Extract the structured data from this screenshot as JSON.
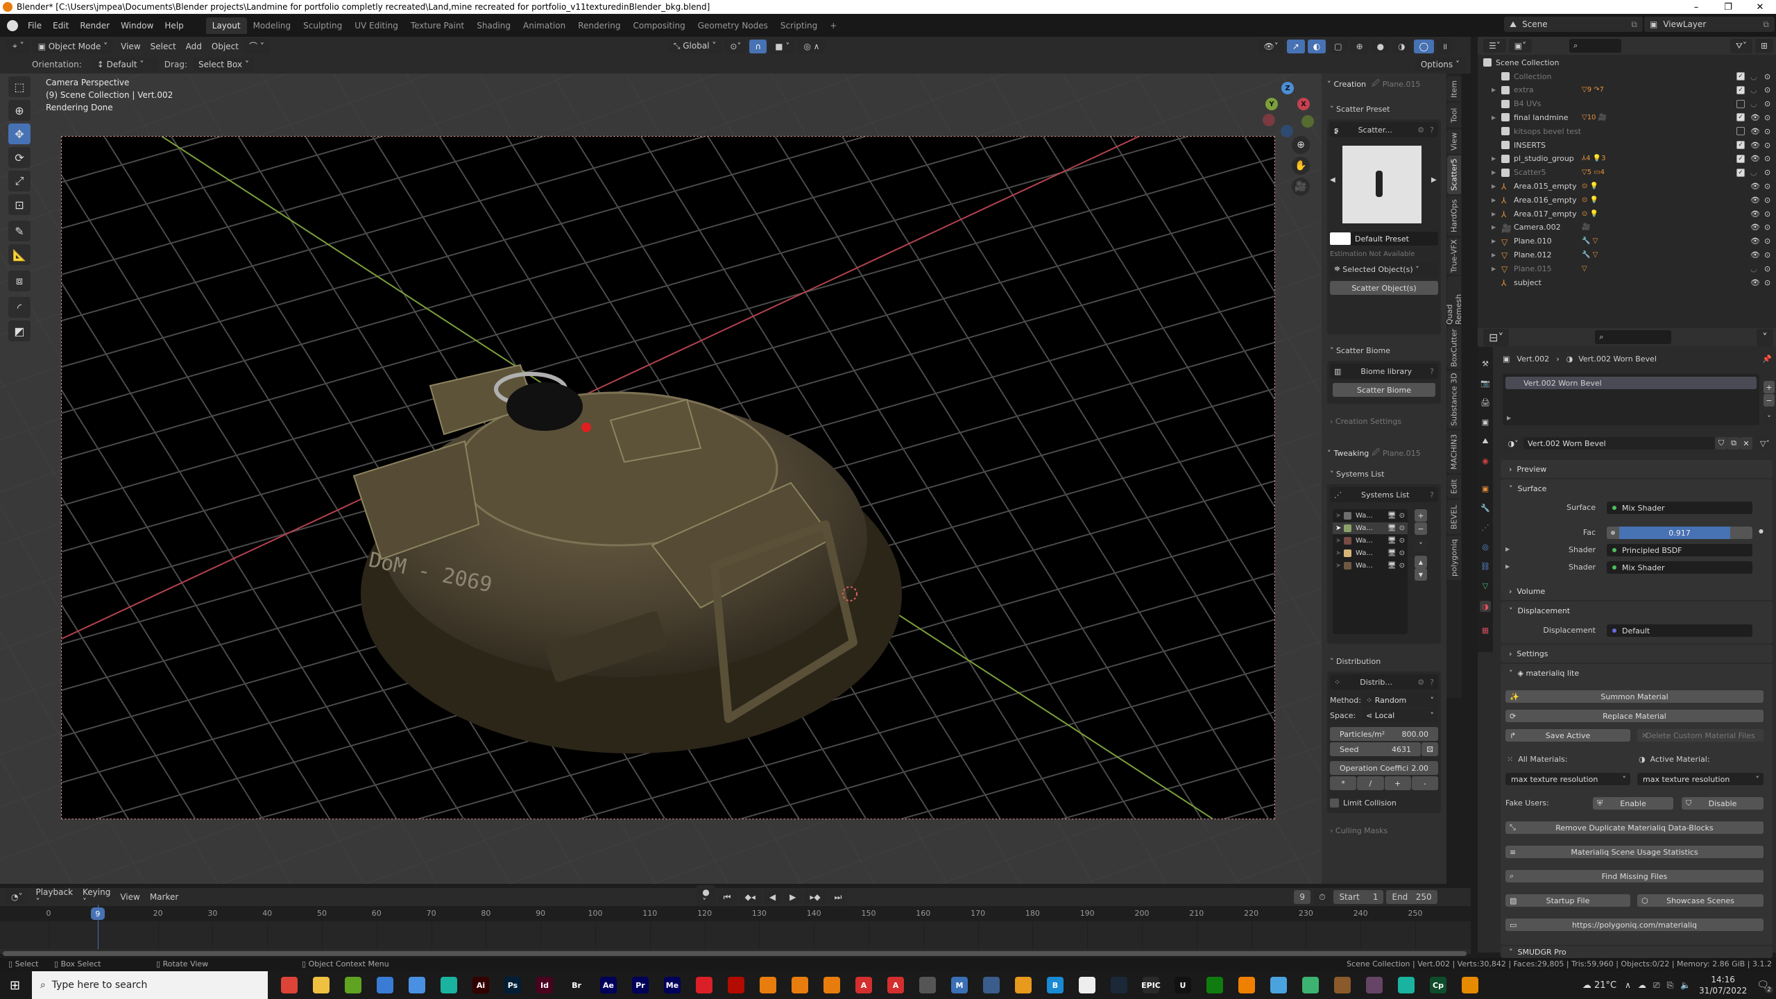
{
  "window": {
    "title": "Blender* [C:\\Users\\jmpea\\Documents\\Blender projects\\Landmine for portfolio completly recreated\\Land,mine recreated for portfolio_v11texturedinBlender_bkg.blend]",
    "controls": [
      "–",
      "❐",
      "✕"
    ]
  },
  "menu": [
    "File",
    "Edit",
    "Render",
    "Window",
    "Help"
  ],
  "workspaces": [
    {
      "label": "Layout",
      "active": true
    },
    {
      "label": "Modeling"
    },
    {
      "label": "Sculpting"
    },
    {
      "label": "UV Editing"
    },
    {
      "label": "Texture Paint"
    },
    {
      "label": "Shading"
    },
    {
      "label": "Animation"
    },
    {
      "label": "Rendering"
    },
    {
      "label": "Compositing"
    },
    {
      "label": "Geometry Nodes"
    },
    {
      "label": "Scripting"
    },
    {
      "label": "+"
    }
  ],
  "scene": {
    "name": "Scene",
    "view_layer": "ViewLayer"
  },
  "viewport_header": {
    "mode": "Object Mode",
    "menus": [
      "View",
      "Select",
      "Add",
      "Object"
    ],
    "transform_orientation": "Global",
    "options_label": "Options"
  },
  "tool_settings": {
    "orientation_label": "Orientation:",
    "orientation_value": "Default",
    "drag_label": "Drag:",
    "drag_value": "Select Box"
  },
  "viewport": {
    "info_lines": [
      "Camera Perspective",
      "(9) Scene Collection | Vert.002",
      "Rendering Done"
    ],
    "gizmo": {
      "x": "X",
      "y": "Y",
      "z": "Z"
    },
    "tools": [
      "select-box",
      "cursor",
      "move",
      "rotate",
      "scale",
      "transform",
      "annotate",
      "measure",
      "add-cube",
      "extrude",
      "knife"
    ],
    "active_tool": "move",
    "colors": {
      "x_axis": "#b5434f",
      "y_axis": "#7da13a",
      "mine": "#4d4430"
    },
    "stencil_text": "DoM - 2069"
  },
  "npanel": {
    "tabs": [
      "Item",
      "Tool",
      "View",
      "Scatter5",
      "HardOps",
      "True-VFX",
      "Quad Remesh",
      "BoxCutter",
      "Substance 3D",
      "MACHIN3",
      "Edit",
      "BEVEL",
      "polygoniq"
    ],
    "active_tab": "Scatter5",
    "creation": {
      "title": "Creation",
      "target": "Plane.015",
      "scatter_preset_label": "Scatter Preset",
      "preset_box_label": "Scatter...",
      "preset_name": "Default Preset",
      "estimation": "Estimation Not Available",
      "selected_objects": "Selected Object(s)",
      "scatter_objects_btn": "Scatter Object(s)",
      "scatter_biome_label": "Scatter Biome",
      "biome_library": "Biome library",
      "scatter_biome_btn": "Scatter Biome",
      "creation_settings": "Creation Settings"
    },
    "tweaking": {
      "title": "Tweaking",
      "target": "Plane.015",
      "systems_list_label": "Systems List",
      "systems_box_label": "Systems List",
      "systems": [
        {
          "name": "Wa...",
          "color": "#6e6e6e",
          "active": false
        },
        {
          "name": "Wa...",
          "color": "#8ba26a",
          "active": true
        },
        {
          "name": "Wa...",
          "color": "#7a4a44",
          "active": false
        },
        {
          "name": "Wa...",
          "color": "#d8b577",
          "active": false
        },
        {
          "name": "Wa...",
          "color": "#6e5a42",
          "active": false
        }
      ],
      "distribution_label": "Distribution",
      "distrib_box_label": "Distrib...",
      "method_label": "Method:",
      "method_value": "Random",
      "space_label": "Space:",
      "space_value": "Local",
      "particles_label": "Particles/m²",
      "particles_value": "800.00",
      "seed_label": "Seed",
      "seed_value": "4631",
      "op_coef_label": "Operation Coeffici",
      "op_coef_value": "2.00",
      "ops": [
        "*",
        "/",
        "+",
        "-"
      ],
      "limit_collision": "Limit Collision",
      "culling_masks": "Culling Masks"
    }
  },
  "outliner": {
    "root": "Scene Collection",
    "items": [
      {
        "name": "Collection",
        "type": "collection",
        "dim": true,
        "checked": true,
        "eye": "hidden",
        "expand": false
      },
      {
        "name": "extra",
        "type": "collection",
        "dim": true,
        "checked": true,
        "eye": "hidden",
        "expand": true,
        "badges": "▽9 ↷7"
      },
      {
        "name": "B4 UVs",
        "type": "collection",
        "dim": true,
        "checked": false,
        "eye": "hidden",
        "expand": false
      },
      {
        "name": "final landmine",
        "type": "collection",
        "checked": true,
        "eye": "visible",
        "expand": true,
        "badges": "▽10 🎥"
      },
      {
        "name": "kitsops bevel test",
        "type": "collection",
        "dim": true,
        "checked": false,
        "eye": "visible",
        "expand": false
      },
      {
        "name": "INSERTS",
        "type": "collection",
        "checked": true,
        "eye": "visible",
        "expand": false
      },
      {
        "name": "pl_studio_group",
        "type": "collection",
        "checked": true,
        "eye": "visible",
        "expand": true,
        "badges": "⅄4 💡3"
      },
      {
        "name": "Scatter5",
        "type": "collection",
        "dim": true,
        "checked": true,
        "eye": "hidden",
        "expand": true,
        "badges": "▽5 ▭4"
      },
      {
        "name": "Area.015_empty",
        "type": "empty",
        "eye": "visible",
        "expand": true,
        "badges": "⊙ 💡"
      },
      {
        "name": "Area.016_empty",
        "type": "empty",
        "eye": "visible",
        "expand": true,
        "badges": "⊙ 💡"
      },
      {
        "name": "Area.017_empty",
        "type": "empty",
        "eye": "visible",
        "expand": true,
        "badges": "⊙ 💡"
      },
      {
        "name": "Camera.002",
        "type": "camera",
        "eye": "visible",
        "expand": true,
        "badges": "🎥"
      },
      {
        "name": "Plane.010",
        "type": "mesh",
        "eye": "visible",
        "expand": true,
        "badges": "🔧 ▽"
      },
      {
        "name": "Plane.012",
        "type": "mesh",
        "eye": "visible",
        "expand": true,
        "badges": "🔧 ▽"
      },
      {
        "name": "Plane.015",
        "type": "mesh",
        "dim": true,
        "eye": "hidden",
        "expand": true,
        "badges": "▽"
      },
      {
        "name": "subject",
        "type": "empty",
        "eye": "visible",
        "expand": false
      }
    ]
  },
  "properties": {
    "breadcrumb": [
      "Vert.002",
      "Vert.002 Worn Bevel"
    ],
    "slot": "Vert.002 Worn Bevel",
    "material_name": "Vert.002 Worn Bevel",
    "sections": {
      "preview": "Preview",
      "surface": "Surface",
      "volume": "Volume",
      "displacement": "Displacement",
      "settings": "Settings",
      "materialiq": "materialiq lite",
      "smudgr": "SMUDGR Pro"
    },
    "surface_label": "Surface",
    "surface_value": "Mix Shader",
    "fac_label": "Fac",
    "fac_value": "0.917",
    "fac_fraction": 0.917,
    "shader1_label": "Shader",
    "shader1_value": "Principled BSDF",
    "shader2_label": "Shader",
    "shader2_value": "Mix Shader",
    "displacement_label": "Displacement",
    "displacement_value": "Default",
    "materialiq": {
      "summon": "Summon Material",
      "replace": "Replace Material",
      "save_active": "Save Active",
      "delete_custom": "Delete Custom Material Files",
      "all_materials": "All Materials:",
      "active_material": "Active Material:",
      "all_res": "max texture resolution",
      "active_res": "max texture resolution",
      "fake_users": "Fake Users:",
      "enable": "Enable",
      "disable": "Disable",
      "remove_dup": "Remove Duplicate Materialiq Data-Blocks",
      "stats": "Materialiq Scene Usage Statistics",
      "find_missing": "Find Missing Files",
      "startup_file": "Startup File",
      "showcase": "Showcase Scenes",
      "url": "https://polygoniq.com/materialiq"
    }
  },
  "timeline": {
    "menus": [
      "Playback",
      "Keying",
      "View",
      "Marker"
    ],
    "current_frame": "9",
    "start_label": "Start",
    "start": "1",
    "end_label": "End",
    "end": "250",
    "ticks": [
      "0",
      "20",
      "30",
      "40",
      "50",
      "60",
      "70",
      "80",
      "90",
      "100",
      "110",
      "120",
      "130",
      "140",
      "150",
      "160",
      "170",
      "180",
      "190",
      "200",
      "210",
      "220",
      "230",
      "240",
      "250"
    ],
    "playhead_label": "9"
  },
  "statusbar": {
    "hints": [
      "Select",
      "Box Select",
      "Rotate View",
      "Object Context Menu"
    ],
    "stats": "Scene Collection | Vert.002 | Verts:30,842 | Faces:29,805 | Tris:59,960 | Objects:0/22 | Memory: 2.86 GiB | 3.1.2"
  },
  "taskbar": {
    "search_placeholder": "Type here to search",
    "apps": [
      {
        "name": "chrome",
        "label": "",
        "color": "#db4437"
      },
      {
        "name": "file-explorer",
        "label": "",
        "color": "#f0c040"
      },
      {
        "name": "app-green",
        "label": "",
        "color": "#5fa320"
      },
      {
        "name": "store",
        "label": "",
        "color": "#3a7bd5"
      },
      {
        "name": "app-blue",
        "label": "",
        "color": "#4a90e2"
      },
      {
        "name": "app-teal",
        "label": "",
        "color": "#1ab3a0"
      },
      {
        "name": "illustrator",
        "label": "Ai",
        "color": "#330000"
      },
      {
        "name": "photoshop",
        "label": "Ps",
        "color": "#001e36"
      },
      {
        "name": "indesign",
        "label": "Id",
        "color": "#49021f"
      },
      {
        "name": "bridge",
        "label": "Br",
        "color": "#1a1a1a"
      },
      {
        "name": "after-effects",
        "label": "Ae",
        "color": "#00005b"
      },
      {
        "name": "premiere",
        "label": "Pr",
        "color": "#00005b"
      },
      {
        "name": "media-encoder",
        "label": "Me",
        "color": "#00005b"
      },
      {
        "name": "creative-cloud",
        "label": "",
        "color": "#da1f26"
      },
      {
        "name": "acrobat",
        "label": "",
        "color": "#b30b00"
      },
      {
        "name": "blender-1",
        "label": "",
        "color": "#e87d0d"
      },
      {
        "name": "blender-2",
        "label": "",
        "color": "#e87d0d"
      },
      {
        "name": "blender-3",
        "label": "",
        "color": "#e87d0d"
      },
      {
        "name": "app-red-a1",
        "label": "A",
        "color": "#d32f2f"
      },
      {
        "name": "app-red-a2",
        "label": "A",
        "color": "#d32f2f"
      },
      {
        "name": "app-scanner",
        "label": "",
        "color": "#555"
      },
      {
        "name": "app-m",
        "label": "M",
        "color": "#3b6fb6"
      },
      {
        "name": "calculator",
        "label": "",
        "color": "#3a5d8c"
      },
      {
        "name": "app-orange",
        "label": "",
        "color": "#e79a1b"
      },
      {
        "name": "app-b",
        "label": "B",
        "color": "#1a8ad4"
      },
      {
        "name": "oculus",
        "label": "",
        "color": "#eee"
      },
      {
        "name": "steam",
        "label": "",
        "color": "#1b2838"
      },
      {
        "name": "epic-games",
        "label": "EPIC",
        "color": "#2a2a2a"
      },
      {
        "name": "unreal",
        "label": "U",
        "color": "#111"
      },
      {
        "name": "xbox",
        "label": "",
        "color": "#107c10"
      },
      {
        "name": "vlc",
        "label": "",
        "color": "#f08000"
      },
      {
        "name": "app-diamond",
        "label": "",
        "color": "#4aa3df"
      },
      {
        "name": "app-sheets",
        "label": "",
        "color": "#3cb371"
      },
      {
        "name": "app-figure",
        "label": "",
        "color": "#8a5a2a"
      },
      {
        "name": "app-v",
        "label": "",
        "color": "#664466"
      },
      {
        "name": "app-brain",
        "label": "",
        "color": "#1ab3a0"
      },
      {
        "name": "captivate",
        "label": "Cp",
        "color": "#0f4d2c"
      },
      {
        "name": "app-monitor",
        "label": "",
        "color": "#e68a00"
      }
    ],
    "weather": "21°C",
    "time": "14:16",
    "date": "31/07/2022",
    "notifications": "2"
  }
}
